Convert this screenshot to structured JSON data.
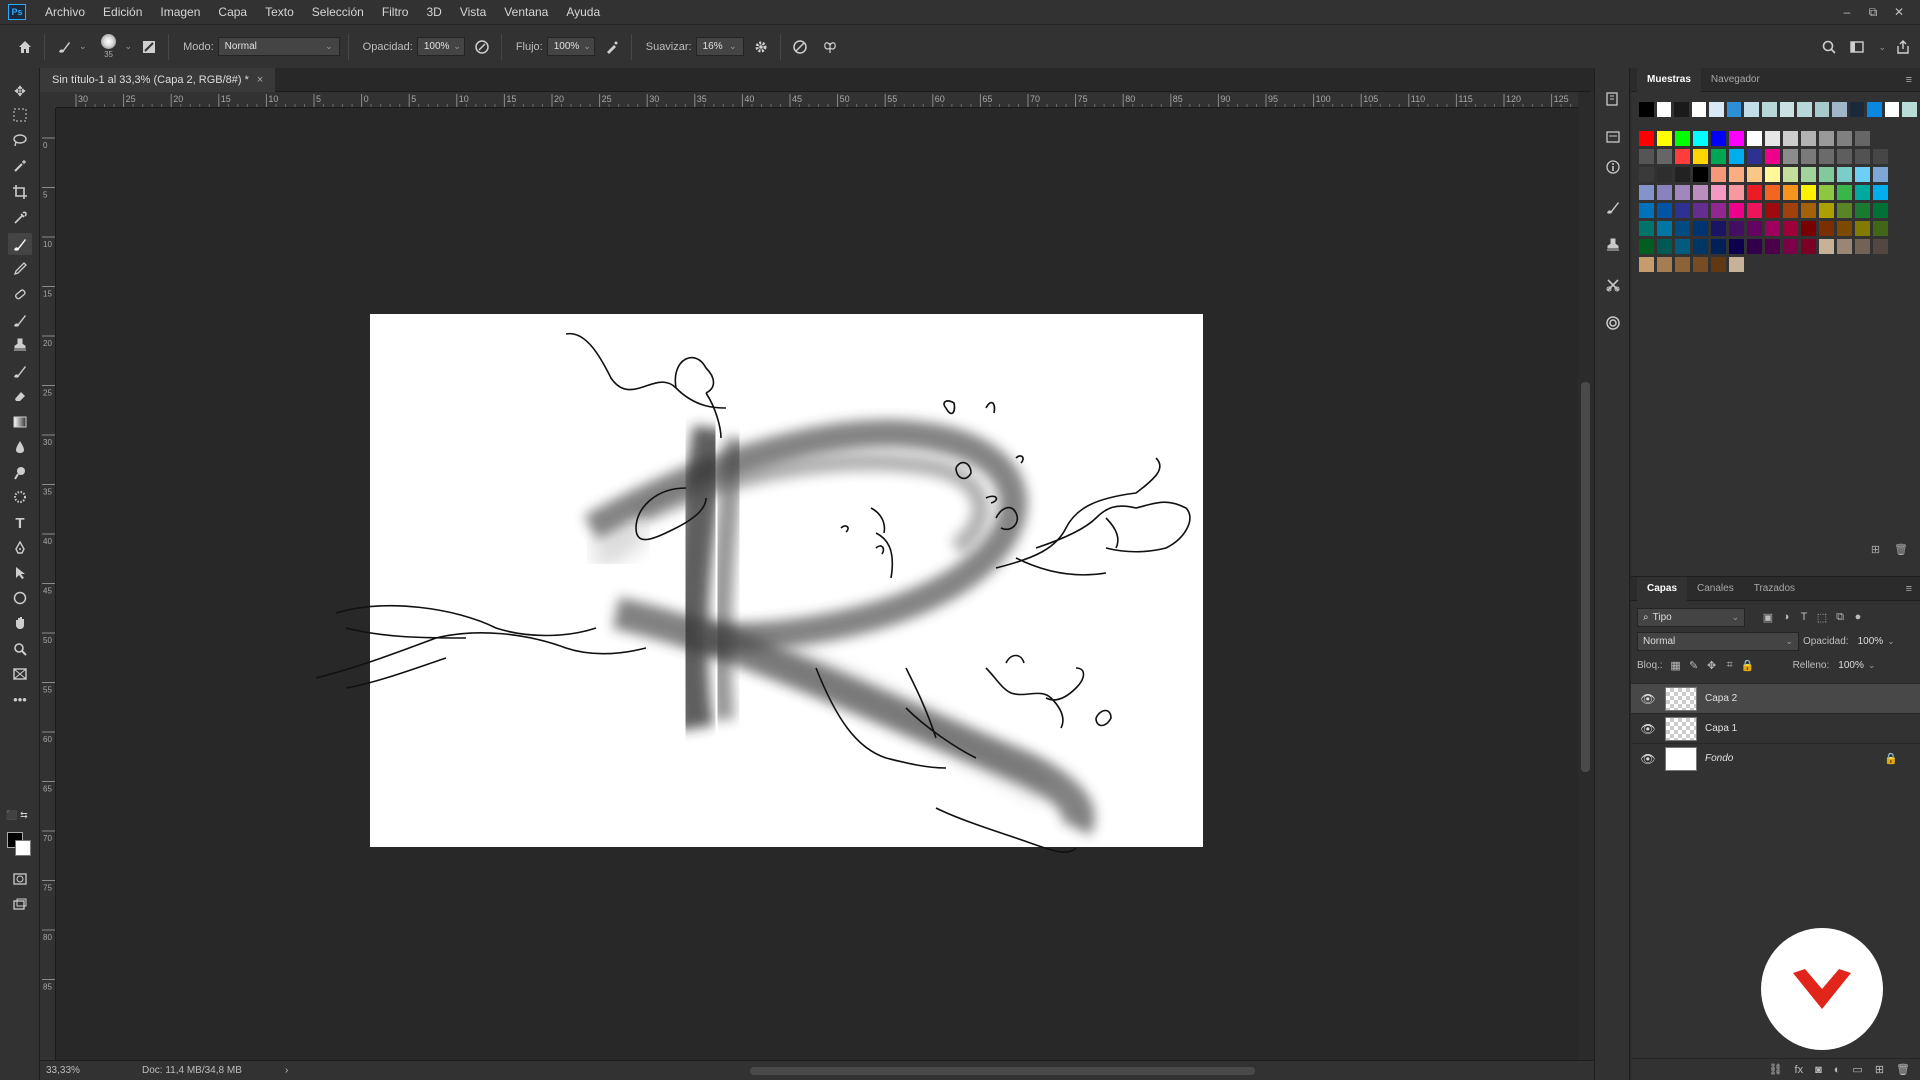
{
  "app": {
    "logo_text": "Ps"
  },
  "menu": [
    "Archivo",
    "Edición",
    "Imagen",
    "Capa",
    "Texto",
    "Selección",
    "Filtro",
    "3D",
    "Vista",
    "Ventana",
    "Ayuda"
  ],
  "window_controls": {
    "minimize": "–",
    "restore": "⧉",
    "close": "✕"
  },
  "options_bar": {
    "brush_size": "35",
    "mode_label": "Modo:",
    "mode_value": "Normal",
    "opacity_label": "Opacidad:",
    "opacity_value": "100%",
    "flow_label": "Flujo:",
    "flow_value": "100%",
    "smoothing_label": "Suavizar:",
    "smoothing_value": "16%"
  },
  "document": {
    "tab_title": "Sin título-1 al 33,3% (Capa 2, RGB/8#) *",
    "tab_close": "×"
  },
  "rulers": {
    "horizontal": [
      "30",
      "25",
      "20",
      "15",
      "10",
      "5",
      "0",
      "5",
      "10",
      "15",
      "20",
      "25",
      "30",
      "35",
      "40",
      "45",
      "50",
      "55",
      "60",
      "65",
      "70",
      "75",
      "80",
      "85",
      "90",
      "95",
      "100",
      "105",
      "110",
      "115",
      "120",
      "125"
    ],
    "vertical": [
      "0",
      "5",
      "10",
      "15",
      "20",
      "25",
      "30",
      "35",
      "40",
      "45",
      "50",
      "55",
      "60",
      "65",
      "70",
      "75",
      "80",
      "85"
    ]
  },
  "status": {
    "zoom": "33,33%",
    "doc_size": "Doc: 11,4 MB/34,8 MB",
    "arrow": "›"
  },
  "swatches_panel": {
    "tabs": [
      "Muestras",
      "Navegador"
    ],
    "rows": [
      [
        "#000000",
        "#ffffff",
        "#1a1a1a",
        "#ffffff",
        "#d9e8f5",
        "#2d8fd6",
        "#c2dce8",
        "#b8d8d8",
        "#c9e1e1",
        "#b7d6d8",
        "#a8c9cc",
        "#9fb7c9",
        "#1b2a3a",
        "#0a87e0",
        "#ffffff",
        "#b8dcd8"
      ],
      [
        "#ff0000",
        "#ffff00",
        "#00ff00",
        "#00ffff",
        "#0000ff",
        "#ff00ff",
        "#ffffff",
        "#e6e6e6",
        "#cccccc",
        "#b3b3b3",
        "#999999",
        "#808080",
        "#666666"
      ],
      [
        "#555555",
        "#666666",
        "#ff3d3d",
        "#ffd400",
        "#00a651",
        "#00aeef",
        "#2e3192",
        "#ec008c",
        "#8c8c8c",
        "#7a7a7a",
        "#6b6b6b",
        "#5e5e5e",
        "#525252",
        "#464646"
      ],
      [
        "#3a3a3a",
        "#2e2e2e",
        "#222222",
        "#000000",
        "#f7977a",
        "#fbad82",
        "#fdc689",
        "#fff79a",
        "#c4df9b",
        "#a2d39c",
        "#82ca9d",
        "#7bcdc8",
        "#6ecff6",
        "#7ea7d8"
      ],
      [
        "#8493ca",
        "#8882be",
        "#a187be",
        "#bc8dbf",
        "#f49ac2",
        "#f6989d",
        "#ed1c24",
        "#f26522",
        "#f7941d",
        "#fff200",
        "#8dc63f",
        "#39b54a",
        "#00a99d",
        "#00aeef"
      ],
      [
        "#0072bc",
        "#0054a6",
        "#2e3192",
        "#662d91",
        "#92278f",
        "#ec008c",
        "#ed145b",
        "#9e0b0f",
        "#a0410d",
        "#a36209",
        "#aba000",
        "#598527",
        "#1a7b30",
        "#007236"
      ],
      [
        "#00746b",
        "#0076a3",
        "#004b80",
        "#003471",
        "#1b1464",
        "#440e62",
        "#630460",
        "#9e005d",
        "#9e0039",
        "#790000",
        "#7b2e00",
        "#7d4900",
        "#827b00",
        "#406618"
      ],
      [
        "#005e20",
        "#005952",
        "#005b7f",
        "#003663",
        "#002157",
        "#0d004c",
        "#32004b",
        "#4b0049",
        "#7b0046",
        "#7a0026",
        "#c7b299",
        "#998675",
        "#736357",
        "#534741"
      ],
      [
        "#c69c6d",
        "#a67c52",
        "#8c6239",
        "#754c24",
        "#603913",
        "#c7b299"
      ]
    ]
  },
  "layers_panel": {
    "tabs": [
      "Capas",
      "Canales",
      "Trazados"
    ],
    "filter_kind": "Tipo",
    "blend_mode": "Normal",
    "opacity_label": "Opacidad:",
    "opacity_value": "100%",
    "lock_label": "Bloq.:",
    "fill_label": "Relleno:",
    "fill_value": "100%",
    "layers": [
      {
        "name": "Capa 2",
        "selected": true,
        "visible": true,
        "locked": false,
        "italic": false
      },
      {
        "name": "Capa 1",
        "selected": false,
        "visible": true,
        "locked": false,
        "italic": false
      },
      {
        "name": "Fondo",
        "selected": false,
        "visible": true,
        "locked": true,
        "italic": true
      }
    ]
  },
  "colors": {
    "accent": "#31a8ff",
    "badge_red": "#e1251b",
    "canvas_bg": "#ffffff"
  }
}
